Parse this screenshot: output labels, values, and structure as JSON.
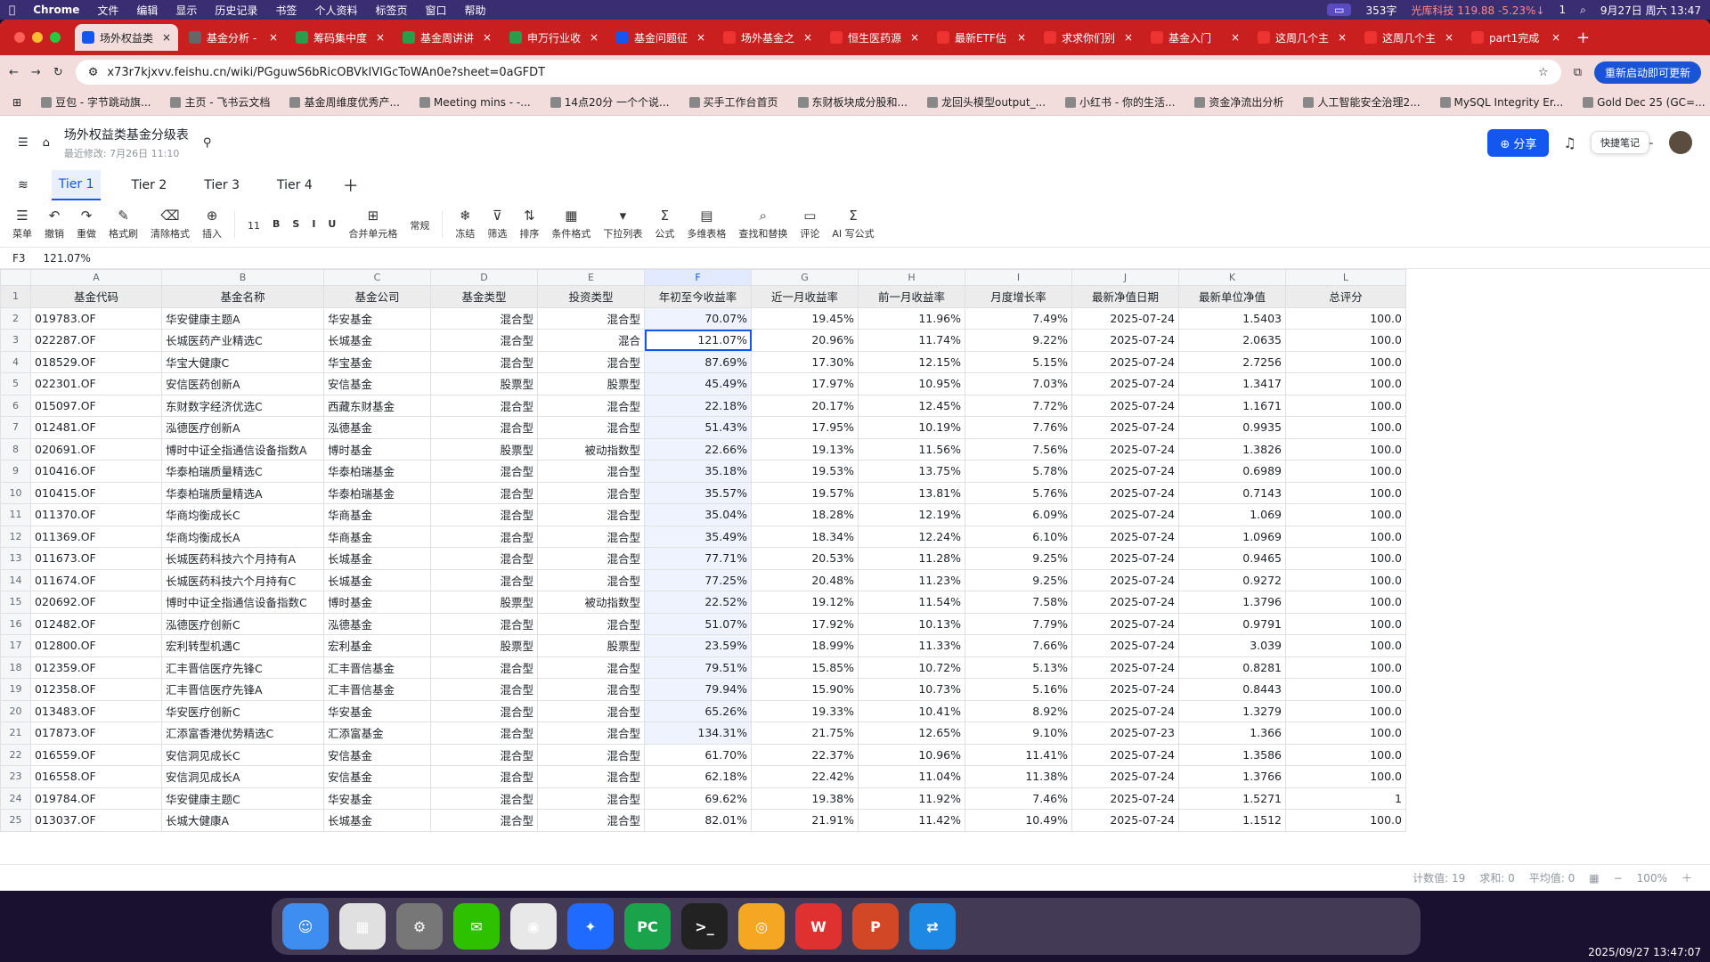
{
  "menubar": {
    "app": "Chrome",
    "items": [
      "文件",
      "编辑",
      "显示",
      "历史记录",
      "书签",
      "个人资料",
      "标签页",
      "窗口",
      "帮助"
    ],
    "battery_info": "353字",
    "stock": "光库科技 119.88 -5.23%↓",
    "wechat_count": "1",
    "datetime": "9月27日 周六 13:47"
  },
  "browser": {
    "tabs": [
      "场外权益类",
      "基金分析 -",
      "筹码集中度",
      "基金周讲讲",
      "申万行业收",
      "基金问题征",
      "场外基金之",
      "恒生医药源",
      "最新ETF估",
      "求求你们别",
      "基金入门",
      "这周几个主",
      "这周几个主",
      "part1完成"
    ],
    "url": "x73r7kjxvv.feishu.cn/wiki/PGguwS6bRicOBVkIVIGcToWAn0e?sheet=0aGFDT",
    "update_label": "重新启动即可更新",
    "bookmarks": [
      "豆包 - 字节跳动旗...",
      "主页 - 飞书云文档",
      "基金周维度优秀产...",
      "Meeting mins - -...",
      "14点20分 一个个说...",
      "买手工作台首页",
      "东财板块成分股和...",
      "龙回头模型output_...",
      "小红书 - 你的生活...",
      "资金净流出分析",
      "人工智能安全治理2...",
      "MySQL Integrity Er...",
      "Gold Dec 25 (GC=..."
    ]
  },
  "doc": {
    "title": "场外权益类基金分级表",
    "modified": "最近修改: 7月26日 11:10",
    "share_label": "分享",
    "quick_note": "快捷笔记"
  },
  "sheet_tabs": [
    "Tier 1",
    "Tier 2",
    "Tier 3",
    "Tier 4"
  ],
  "toolbar": {
    "items": [
      "菜单",
      "撤销",
      "重做",
      "格式刷",
      "清除格式",
      "插入",
      "11",
      "合并单元格",
      "常规",
      "冻结",
      "筛选",
      "排序",
      "条件格式",
      "下拉列表",
      "公式",
      "多维表格",
      "查找和替换",
      "评论",
      "AI 写公式"
    ]
  },
  "formula": {
    "cell": "F3",
    "value": "121.07%"
  },
  "columns": [
    "A",
    "B",
    "C",
    "D",
    "E",
    "F",
    "G",
    "H",
    "I",
    "J",
    "K",
    "L"
  ],
  "header_row": [
    "基金代码",
    "基金名称",
    "基金公司",
    "基金类型",
    "投资类型",
    "年初至今收益率",
    "近一月收益率",
    "前一月收益率",
    "月度增长率",
    "最新净值日期",
    "最新单位净值",
    "总评分"
  ],
  "rows": [
    [
      "019783.OF",
      "华安健康主题A",
      "华安基金",
      "混合型",
      "混合型",
      "70.07%",
      "19.45%",
      "11.96%",
      "7.49%",
      "2025-07-24",
      "1.5403",
      "100.0"
    ],
    [
      "022287.OF",
      "长城医药产业精选C",
      "长城基金",
      "混合型",
      "混合",
      "121.07%",
      "20.96%",
      "11.74%",
      "9.22%",
      "2025-07-24",
      "2.0635",
      "100.0"
    ],
    [
      "018529.OF",
      "华宝大健康C",
      "华宝基金",
      "混合型",
      "混合型",
      "87.69%",
      "17.30%",
      "12.15%",
      "5.15%",
      "2025-07-24",
      "2.7256",
      "100.0"
    ],
    [
      "022301.OF",
      "安信医药创新A",
      "安信基金",
      "股票型",
      "股票型",
      "45.49%",
      "17.97%",
      "10.95%",
      "7.03%",
      "2025-07-24",
      "1.3417",
      "100.0"
    ],
    [
      "015097.OF",
      "东财数字经济优选C",
      "西藏东财基金",
      "混合型",
      "混合型",
      "22.18%",
      "20.17%",
      "12.45%",
      "7.72%",
      "2025-07-24",
      "1.1671",
      "100.0"
    ],
    [
      "012481.OF",
      "泓德医疗创新A",
      "泓德基金",
      "混合型",
      "混合型",
      "51.43%",
      "17.95%",
      "10.19%",
      "7.76%",
      "2025-07-24",
      "0.9935",
      "100.0"
    ],
    [
      "020691.OF",
      "博时中证全指通信设备指数A",
      "博时基金",
      "股票型",
      "被动指数型",
      "22.66%",
      "19.13%",
      "11.56%",
      "7.56%",
      "2025-07-24",
      "1.3826",
      "100.0"
    ],
    [
      "010416.OF",
      "华泰柏瑞质量精选C",
      "华泰柏瑞基金",
      "混合型",
      "混合型",
      "35.18%",
      "19.53%",
      "13.75%",
      "5.78%",
      "2025-07-24",
      "0.6989",
      "100.0"
    ],
    [
      "010415.OF",
      "华泰柏瑞质量精选A",
      "华泰柏瑞基金",
      "混合型",
      "混合型",
      "35.57%",
      "19.57%",
      "13.81%",
      "5.76%",
      "2025-07-24",
      "0.7143",
      "100.0"
    ],
    [
      "011370.OF",
      "华商均衡成长C",
      "华商基金",
      "混合型",
      "混合型",
      "35.04%",
      "18.28%",
      "12.19%",
      "6.09%",
      "2025-07-24",
      "1.069",
      "100.0"
    ],
    [
      "011369.OF",
      "华商均衡成长A",
      "华商基金",
      "混合型",
      "混合型",
      "35.49%",
      "18.34%",
      "12.24%",
      "6.10%",
      "2025-07-24",
      "1.0969",
      "100.0"
    ],
    [
      "011673.OF",
      "长城医药科技六个月持有A",
      "长城基金",
      "混合型",
      "混合型",
      "77.71%",
      "20.53%",
      "11.28%",
      "9.25%",
      "2025-07-24",
      "0.9465",
      "100.0"
    ],
    [
      "011674.OF",
      "长城医药科技六个月持有C",
      "长城基金",
      "混合型",
      "混合型",
      "77.25%",
      "20.48%",
      "11.23%",
      "9.25%",
      "2025-07-24",
      "0.9272",
      "100.0"
    ],
    [
      "020692.OF",
      "博时中证全指通信设备指数C",
      "博时基金",
      "股票型",
      "被动指数型",
      "22.52%",
      "19.12%",
      "11.54%",
      "7.58%",
      "2025-07-24",
      "1.3796",
      "100.0"
    ],
    [
      "012482.OF",
      "泓德医疗创新C",
      "泓德基金",
      "混合型",
      "混合型",
      "51.07%",
      "17.92%",
      "10.13%",
      "7.79%",
      "2025-07-24",
      "0.9791",
      "100.0"
    ],
    [
      "012800.OF",
      "宏利转型机遇C",
      "宏利基金",
      "股票型",
      "股票型",
      "23.59%",
      "18.99%",
      "11.33%",
      "7.66%",
      "2025-07-24",
      "3.039",
      "100.0"
    ],
    [
      "012359.OF",
      "汇丰晋信医疗先锋C",
      "汇丰晋信基金",
      "混合型",
      "混合型",
      "79.51%",
      "15.85%",
      "10.72%",
      "5.13%",
      "2025-07-24",
      "0.8281",
      "100.0"
    ],
    [
      "012358.OF",
      "汇丰晋信医疗先锋A",
      "汇丰晋信基金",
      "混合型",
      "混合型",
      "79.94%",
      "15.90%",
      "10.73%",
      "5.16%",
      "2025-07-24",
      "0.8443",
      "100.0"
    ],
    [
      "013483.OF",
      "华安医疗创新C",
      "华安基金",
      "混合型",
      "混合型",
      "65.26%",
      "19.33%",
      "10.41%",
      "8.92%",
      "2025-07-24",
      "1.3279",
      "100.0"
    ],
    [
      "017873.OF",
      "汇添富香港优势精选C",
      "汇添富基金",
      "混合型",
      "混合型",
      "134.31%",
      "21.75%",
      "12.65%",
      "9.10%",
      "2025-07-23",
      "1.366",
      "100.0"
    ],
    [
      "016559.OF",
      "安信洞见成长C",
      "安信基金",
      "混合型",
      "混合型",
      "61.70%",
      "22.37%",
      "10.96%",
      "11.41%",
      "2025-07-24",
      "1.3586",
      "100.0"
    ],
    [
      "016558.OF",
      "安信洞见成长A",
      "安信基金",
      "混合型",
      "混合型",
      "62.18%",
      "22.42%",
      "11.04%",
      "11.38%",
      "2025-07-24",
      "1.3766",
      "100.0"
    ],
    [
      "019784.OF",
      "华安健康主题C",
      "华安基金",
      "混合型",
      "混合型",
      "69.62%",
      "19.38%",
      "11.92%",
      "7.46%",
      "2025-07-24",
      "1.5271",
      "1"
    ],
    [
      "013037.OF",
      "长城大健康A",
      "长城基金",
      "混合型",
      "混合型",
      "82.01%",
      "21.91%",
      "11.42%",
      "10.49%",
      "2025-07-24",
      "1.1512",
      "100.0"
    ]
  ],
  "status": {
    "count": "计数值: 19",
    "sum": "求和: 0",
    "avg": "平均值: 0",
    "zoom": "100%"
  },
  "dock": [
    "Finder",
    "Launchpad",
    "Settings",
    "WeChat",
    "Chrome",
    "Lark",
    "PyCharm",
    "Terminal",
    "Notes",
    "WPS",
    "PowerPoint",
    "Screen Share"
  ],
  "screen_timestamp": "2025/09/27 13:47:07"
}
